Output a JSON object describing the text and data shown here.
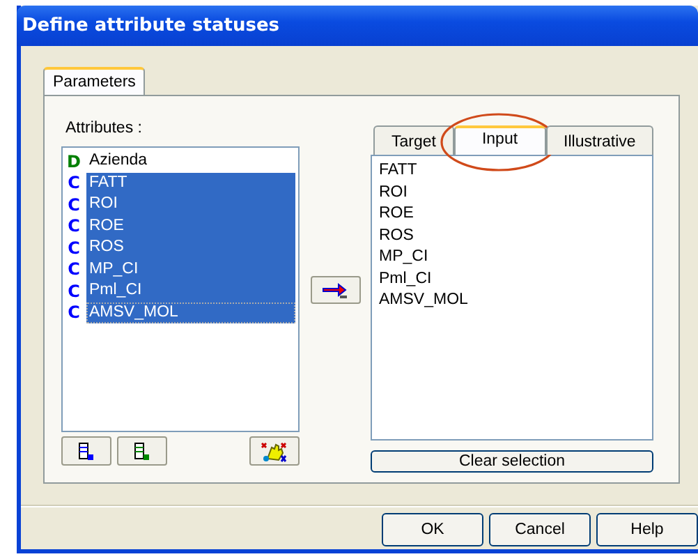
{
  "window": {
    "title": "Define attribute statuses"
  },
  "tabs": [
    {
      "label": "Parameters",
      "selected": true
    }
  ],
  "attributes": {
    "label": "Attributes :",
    "items": [
      {
        "mark": "D",
        "color": "#008000",
        "name": "Azienda",
        "selected": false,
        "focused": false
      },
      {
        "mark": "C",
        "color": "#0000ff",
        "name": "FATT",
        "selected": true,
        "focused": false
      },
      {
        "mark": "C",
        "color": "#0000ff",
        "name": "ROI",
        "selected": true,
        "focused": false
      },
      {
        "mark": "C",
        "color": "#0000ff",
        "name": "ROE",
        "selected": true,
        "focused": false
      },
      {
        "mark": "C",
        "color": "#0000ff",
        "name": "ROS",
        "selected": true,
        "focused": false
      },
      {
        "mark": "C",
        "color": "#0000ff",
        "name": "MP_CI",
        "selected": true,
        "focused": false
      },
      {
        "mark": "C",
        "color": "#0000ff",
        "name": "Pml_CI",
        "selected": true,
        "focused": false
      },
      {
        "mark": "C",
        "color": "#0000ff",
        "name": "AMSV_MOL",
        "selected": true,
        "focused": true
      }
    ]
  },
  "status_tabs": [
    {
      "label": "Target",
      "selected": false,
      "highlighted": false
    },
    {
      "label": "Input",
      "selected": true,
      "highlighted": true
    },
    {
      "label": "Illustrative",
      "selected": false,
      "highlighted": false
    }
  ],
  "status_items": [
    "FATT",
    "ROI",
    "ROE",
    "ROS",
    "MP_CI",
    "Pml_CI",
    "AMSV_MOL"
  ],
  "clear_button": "Clear selection",
  "buttons": [
    "OK",
    "Cancel",
    "Help"
  ]
}
